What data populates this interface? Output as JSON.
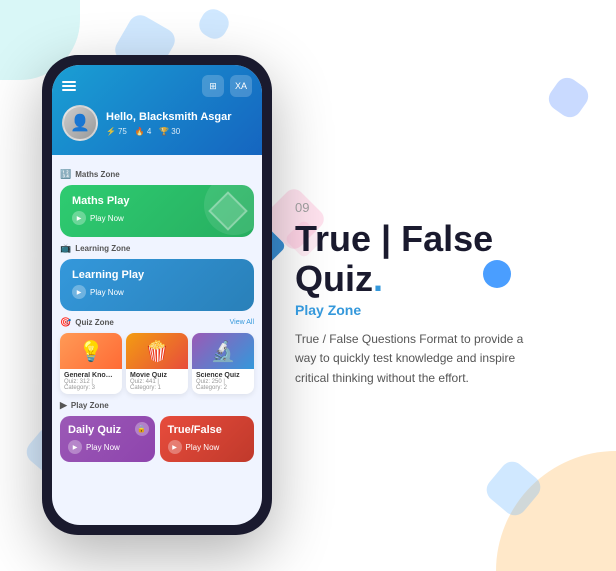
{
  "background": {
    "shapes": [
      "teal-corner",
      "orange-corner",
      "blue-diamonds",
      "blue-circle"
    ]
  },
  "phone": {
    "header": {
      "greeting": "Hello, Blacksmith Asgar",
      "stats": [
        {
          "icon": "⚡",
          "value": "75"
        },
        {
          "icon": "🔥",
          "value": "4"
        },
        {
          "icon": "🏆",
          "value": "30"
        }
      ]
    },
    "sections": [
      {
        "id": "maths-zone",
        "label": "Maths Zone",
        "card": {
          "title": "Maths Play",
          "button": "Play Now"
        }
      },
      {
        "id": "learning-zone",
        "label": "Learning Zone",
        "card": {
          "title": "Learning Play",
          "button": "Play Now"
        }
      },
      {
        "id": "quiz-zone",
        "label": "Quiz Zone",
        "view_all": "View All",
        "quizzes": [
          {
            "name": "General Knowl...",
            "meta": "Quiz: 312 | Category: 3",
            "emoji": "💡"
          },
          {
            "name": "Movie Quiz",
            "meta": "Quiz: 441 | Category: 1",
            "emoji": "🍿"
          },
          {
            "name": "Science Quiz",
            "meta": "Quiz: 250 | Category: 2",
            "emoji": "🔬"
          }
        ]
      },
      {
        "id": "play-zone",
        "label": "Play Zone",
        "cards": [
          {
            "title": "Daily Quiz",
            "button": "Play Now",
            "has_lock": true
          },
          {
            "title": "True/False",
            "button": "Play Now",
            "has_lock": false
          }
        ]
      }
    ]
  },
  "right_panel": {
    "slide_number": "09",
    "title_line1": "True | False",
    "title_line2": "Quiz",
    "title_dot": ".",
    "subtitle": "Play Zone",
    "description": "True / False Questions Format to provide a way to quickly test knowledge and inspire critical thinking without the effort."
  }
}
